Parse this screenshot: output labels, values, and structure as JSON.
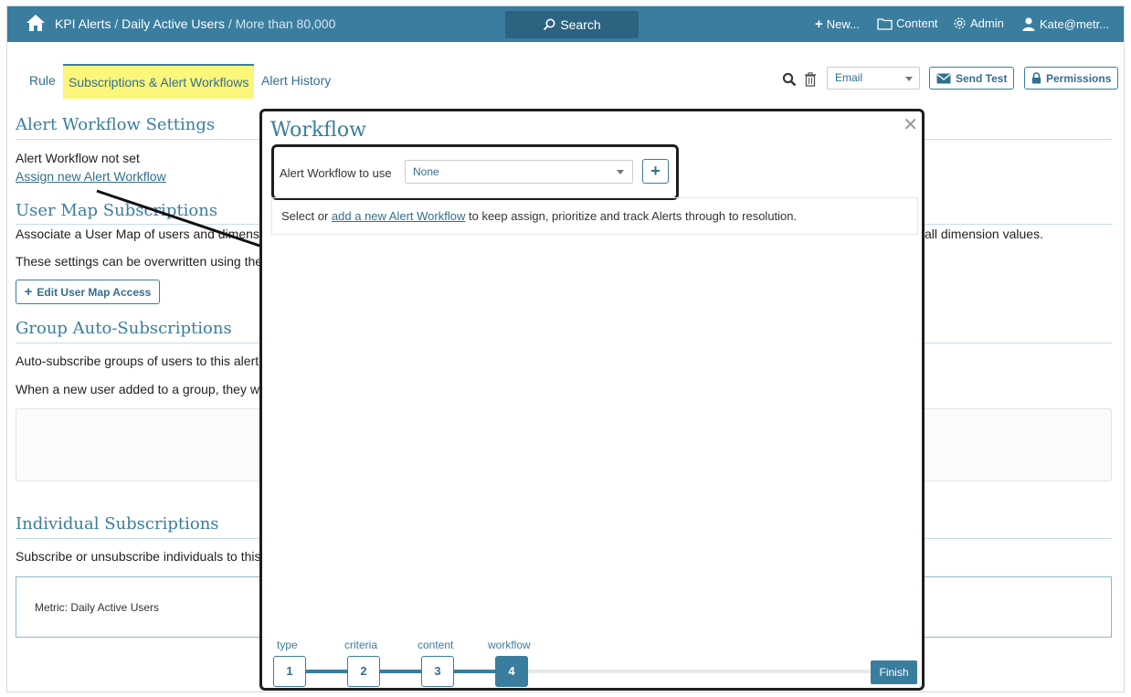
{
  "topbar": {
    "breadcrumb_1": "KPI Alerts",
    "breadcrumb_2": "Daily Active Users",
    "breadcrumb_3": "More than 80,000",
    "separator": " / ",
    "search_label": "Search",
    "new_label": "New...",
    "content_label": "Content",
    "admin_label": "Admin",
    "user_label": "Kate@metr...",
    "bar_color": "#3a7d9e"
  },
  "tabs": [
    {
      "label": "Rule"
    },
    {
      "label": "Subscriptions & Alert Workflows"
    },
    {
      "label": "Alert History"
    }
  ],
  "toolbar": {
    "delivery_value": "Email",
    "send_test_label": "Send Test",
    "permissions_label": "Permissions"
  },
  "main": {
    "alert_workflow_heading": "Alert Workflow Settings",
    "alert_workflow_status": "Alert Workflow not set",
    "assign_link": "Assign new Alert Workflow",
    "user_map_heading": "User Map Subscriptions",
    "user_map_desc_left": "Associate a User Map of users and dimens",
    "user_map_desc_right": "all dimension values.",
    "overwrite_desc": "These settings can be overwritten using the",
    "edit_user_map_label": "Edit User Map Access",
    "group_heading": "Group Auto-Subscriptions",
    "group_desc": "Auto-subscribe groups of users to this alert",
    "group_new_user_desc": "When a new user added to a group, they w",
    "individual_heading": "Individual Subscriptions",
    "individual_desc": "Subscribe or unsubscribe individuals to this",
    "metric_label": "Metric: Daily Active Users"
  },
  "modal": {
    "title": "Workflow",
    "close_glyph": "✕",
    "workflow_label": "Alert Workflow to use",
    "workflow_value": "None",
    "add_glyph": "+",
    "info_prefix": "Select or ",
    "info_link": "add a new Alert Workflow",
    "info_suffix": " to keep assign, prioritize and track Alerts through to resolution.",
    "steps": [
      {
        "label": "type",
        "number": "1"
      },
      {
        "label": "criteria",
        "number": "2"
      },
      {
        "label": "content",
        "number": "3"
      },
      {
        "label": "workflow",
        "number": "4"
      }
    ],
    "finish_label": "Finish"
  }
}
